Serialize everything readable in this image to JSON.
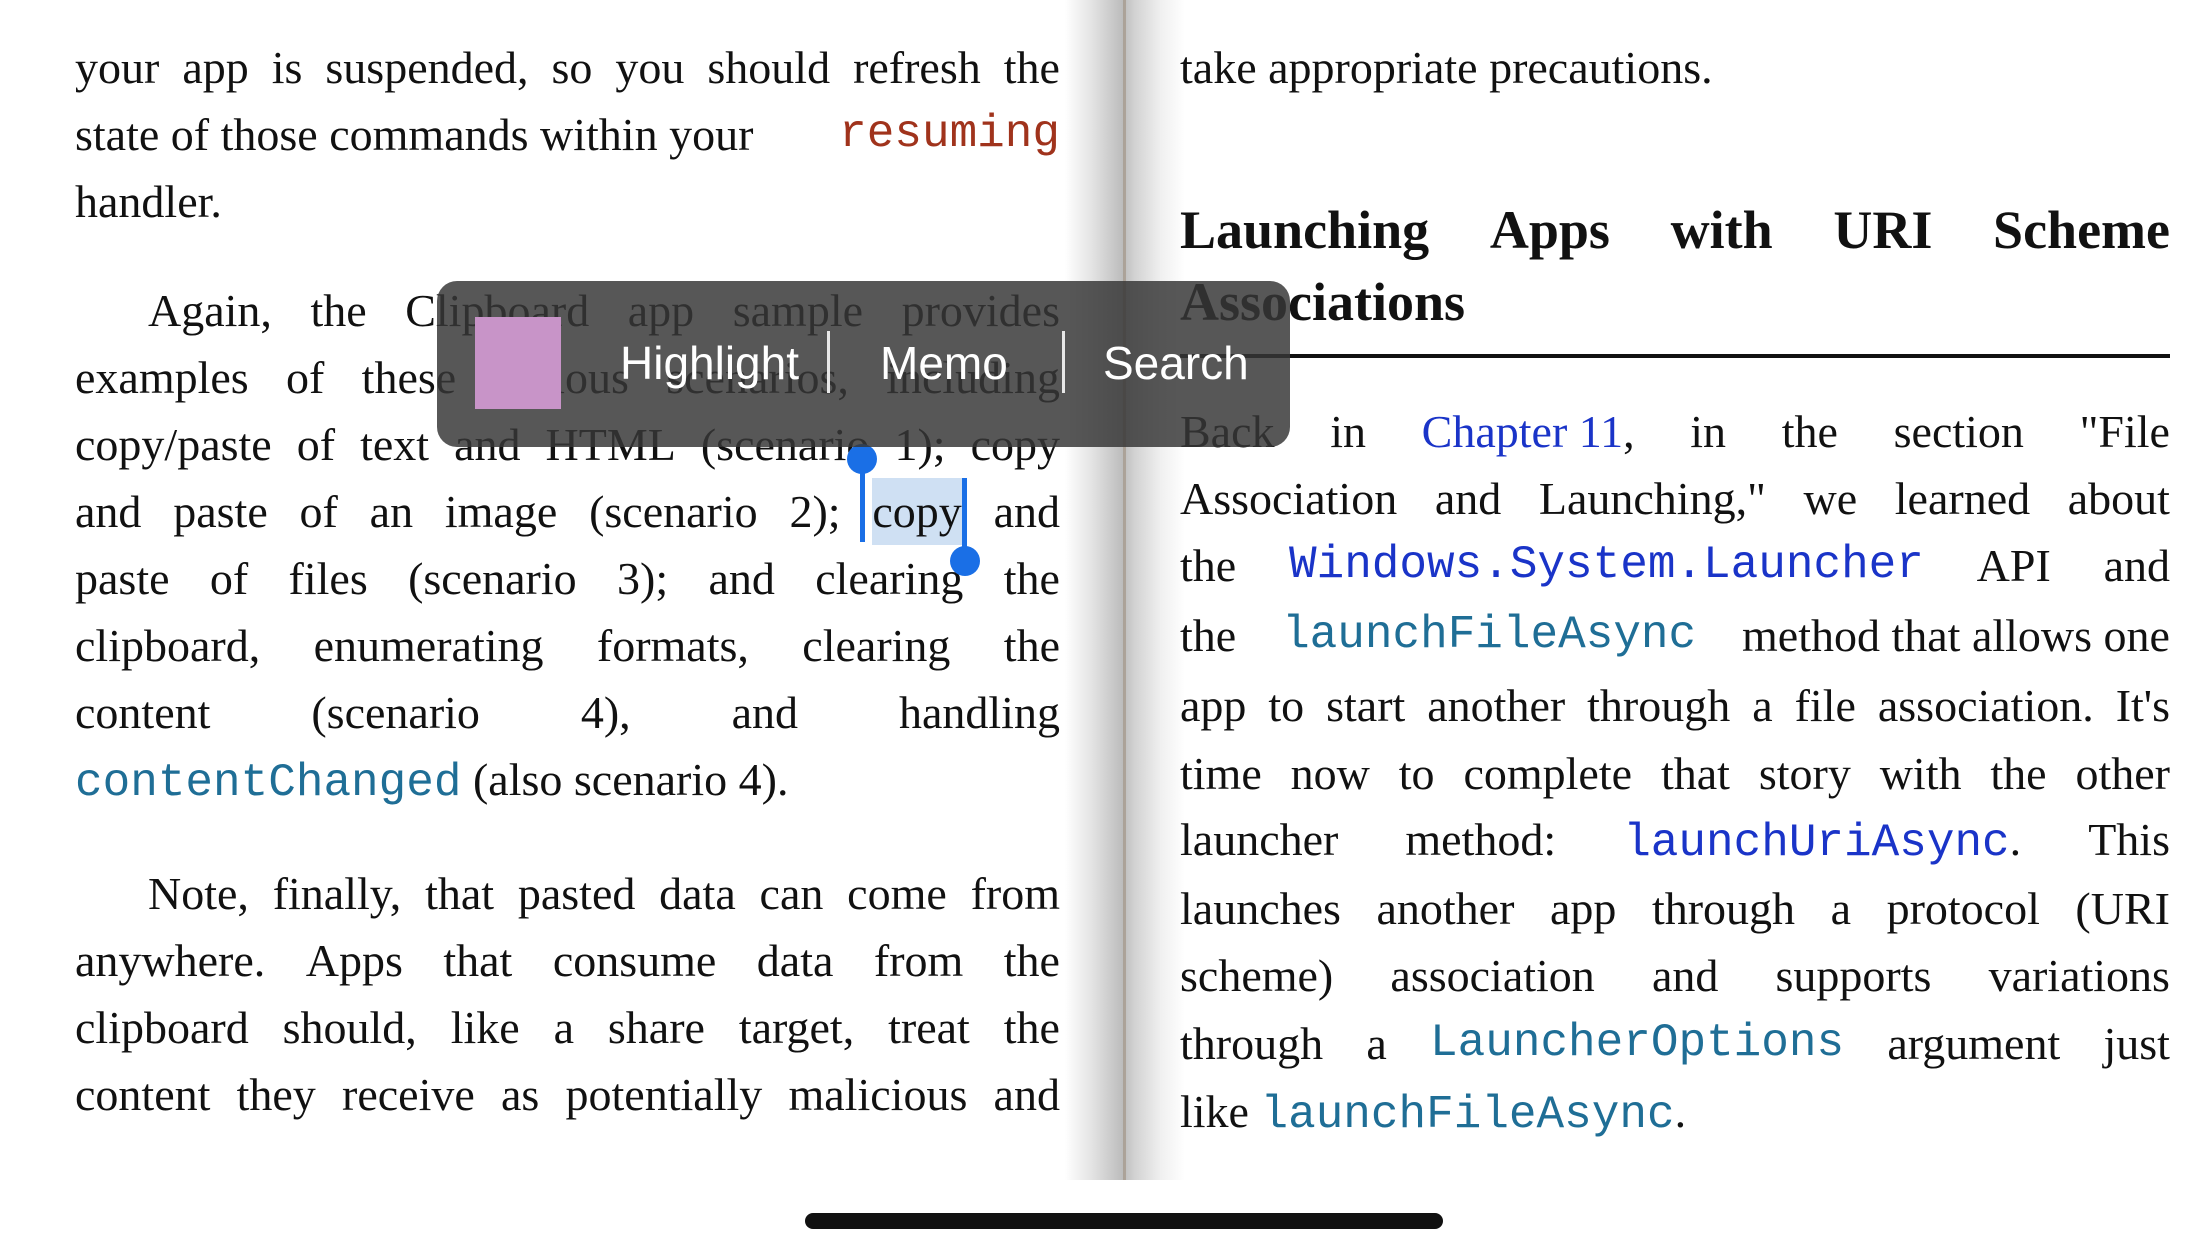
{
  "left_page": {
    "lines": [
      [
        "your",
        "app",
        "is",
        "suspended,",
        "so",
        "you",
        "should",
        "refresh",
        "the"
      ],
      [
        "state of those commands within your"
      ],
      [
        "handler."
      ],
      [
        "Again,",
        "the",
        "Clipboard",
        "app",
        "sample",
        "provides"
      ],
      [
        "examples",
        "of",
        "these",
        "various",
        "scenarios,",
        "including"
      ],
      [
        "copy/paste",
        "of",
        "text",
        "and",
        "HTML",
        "(scenario",
        "1);",
        "copy"
      ],
      [
        "and",
        "paste",
        "of",
        "an",
        "image",
        "(scenario",
        "2);"
      ],
      [
        "paste",
        "of",
        "files",
        "(scenario",
        "3);",
        "and",
        "clearing",
        "the"
      ],
      [
        "clipboard,",
        "enumerating",
        "formats,",
        "clearing",
        "the"
      ],
      [
        "content",
        "(scenario",
        "4),",
        "and",
        "handling"
      ],
      [
        "(also scenario 4)."
      ],
      [
        "Note,",
        "finally,",
        "that",
        "pasted",
        "data",
        "can",
        "come",
        "from"
      ],
      [
        "anywhere.",
        "Apps",
        "that",
        "consume",
        "data",
        "from",
        "the"
      ],
      [
        "clipboard",
        "should,",
        "like",
        "a",
        "share",
        "target,",
        "treat",
        "the"
      ],
      [
        "content",
        "they",
        "receive",
        "as",
        "potentially",
        "malicious",
        "and"
      ]
    ],
    "code_resuming": "resuming",
    "selected_word": "copy",
    "after_selected": "and",
    "code_contentChanged": "contentChanged"
  },
  "right_page": {
    "line_precautions": "take appropriate precautions.",
    "heading": [
      "Launching",
      "Apps",
      "with",
      "URI",
      "Scheme"
    ],
    "heading_line2": "Associations",
    "lines": {
      "l1": [
        "Back",
        "in"
      ],
      "l1_link": "Chapter 11",
      "l1_rest": [
        ",",
        "in",
        "the",
        "section",
        "\"File"
      ],
      "l2": [
        "Association",
        "and",
        "Launching,\"",
        "we",
        "learned",
        "about"
      ],
      "l3_a": "the",
      "l3_code": "Windows.System.Launcher",
      "l3_b": [
        "API",
        "and"
      ],
      "l4_a": "the",
      "l4_code": "launchFileAsync",
      "l4_b": "method that allows one",
      "l5": [
        "app",
        "to",
        "start",
        "another",
        "through",
        "a",
        "file",
        "association.",
        "It's"
      ],
      "l6": [
        "time",
        "now",
        "to",
        "complete",
        "that",
        "story",
        "with",
        "the",
        "other"
      ],
      "l7_a": [
        "launcher",
        "method:"
      ],
      "l7_code": "launchUriAsync",
      "l7_b": [
        ".",
        "This"
      ],
      "l8": [
        "launches",
        "another",
        "app",
        "through",
        "a",
        "protocol",
        "(URI"
      ],
      "l9": [
        "scheme)",
        "association",
        "and",
        "supports",
        "variations"
      ],
      "l10_a": [
        "through",
        "a"
      ],
      "l10_code": "LauncherOptions",
      "l10_b": [
        "argument",
        "just"
      ],
      "l11_a": "like",
      "l11_code": "launchFileAsync",
      "l11_b": "."
    }
  },
  "context_menu": {
    "highlight": "Highlight",
    "memo": "Memo",
    "search": "Search",
    "swatch_color": "#c894c8"
  },
  "colors": {
    "selection": "#cfe0f3",
    "handle": "#1a6fe6",
    "link": "#1a34c8",
    "code_red": "#a0331c",
    "code_teal": "#1f6e96"
  }
}
